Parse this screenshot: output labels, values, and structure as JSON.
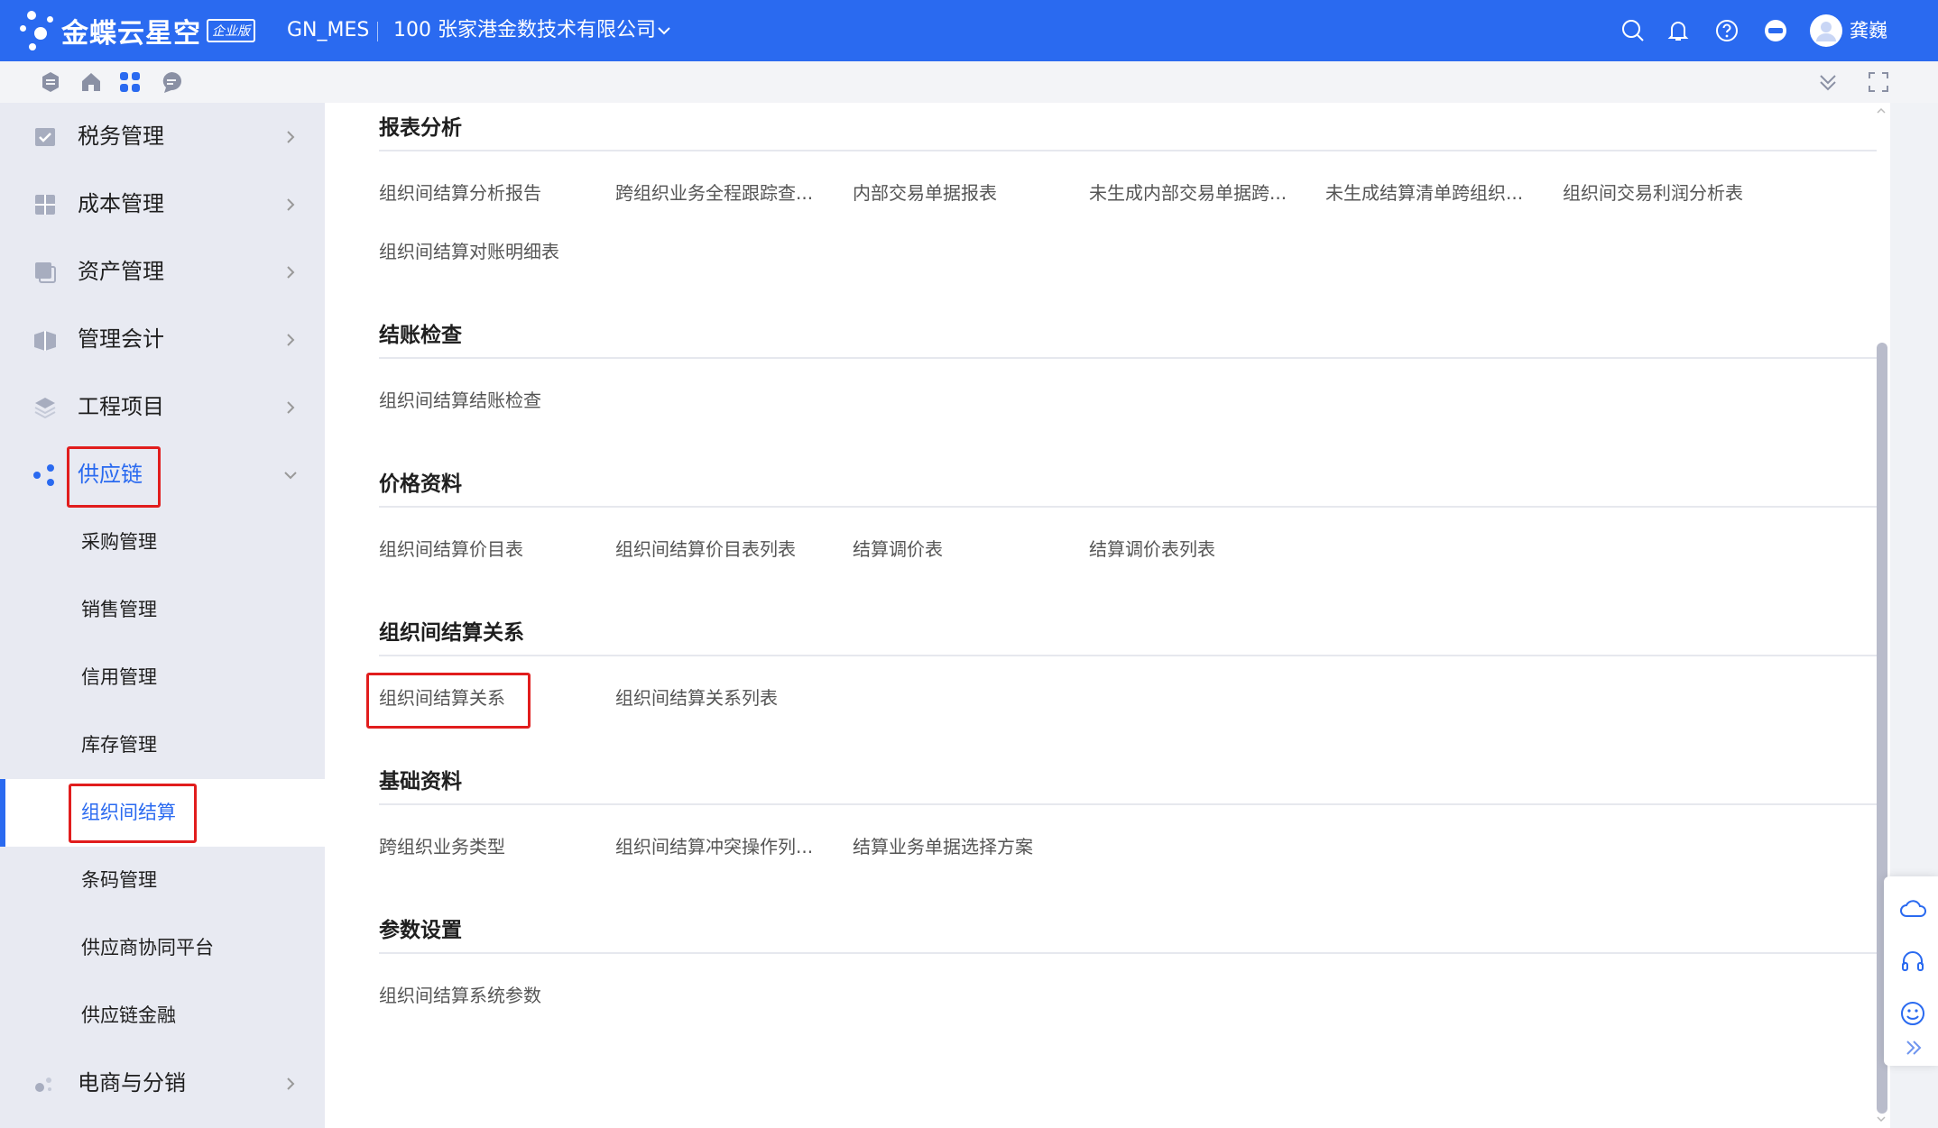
{
  "topbar": {
    "brand": "金蝶云星空",
    "edition_badge": "企业版",
    "app_name": "GN_MES",
    "org_name": "100 张家港金数技术有限公司",
    "user_name": "龚巍",
    "icons": [
      "search-icon",
      "bell-icon",
      "help-icon",
      "minus-circle-icon",
      "avatar"
    ]
  },
  "subbar": {
    "left_icons": [
      "logo-mini-icon",
      "home-icon",
      "apps-grid-icon",
      "chat-icon"
    ],
    "right_icons": [
      "collapse-down-icon",
      "fullscreen-icon"
    ]
  },
  "sidebar": {
    "items": [
      {
        "label": "税务管理",
        "icon": "tax-icon"
      },
      {
        "label": "成本管理",
        "icon": "cost-icon"
      },
      {
        "label": "资产管理",
        "icon": "asset-icon"
      },
      {
        "label": "管理会计",
        "icon": "accounting-icon"
      },
      {
        "label": "工程项目",
        "icon": "layers-icon"
      },
      {
        "label": "供应链",
        "icon": "supply-chain-icon",
        "expanded": true
      }
    ],
    "sub_items": [
      "采购管理",
      "销售管理",
      "信用管理",
      "库存管理",
      "组织间结算",
      "条码管理",
      "供应商协同平台",
      "供应链金融"
    ],
    "active_sub": "组织间结算",
    "last_item": {
      "label": "电商与分销",
      "icon": "ecommerce-icon"
    }
  },
  "main": {
    "sections": [
      {
        "title": "报表分析",
        "links": [
          "组织间结算分析报告",
          "跨组织业务全程跟踪查...",
          "内部交易单据报表",
          "未生成内部交易单据跨...",
          "未生成结算清单跨组织...",
          "组织间交易利润分析表",
          "组织间结算对账明细表"
        ]
      },
      {
        "title": "结账检查",
        "links": [
          "组织间结算结账检查"
        ]
      },
      {
        "title": "价格资料",
        "links": [
          "组织间结算价目表",
          "组织间结算价目表列表",
          "结算调价表",
          "结算调价表列表"
        ]
      },
      {
        "title": "组织间结算关系",
        "links": [
          "组织间结算关系",
          "组织间结算关系列表"
        ]
      },
      {
        "title": "基础资料",
        "links": [
          "跨组织业务类型",
          "组织间结算冲突操作列...",
          "结算业务单据选择方案"
        ]
      },
      {
        "title": "参数设置",
        "links": [
          "组织间结算系统参数"
        ]
      }
    ]
  },
  "float_panel": {
    "icons": [
      "cloud-icon",
      "headset-icon",
      "smile-icon",
      "double-chevron-icon"
    ]
  },
  "colors": {
    "brand_blue": "#2a6af0",
    "highlight_red": "#e11d1d",
    "sidebar_bg": "#e8eaf2"
  }
}
